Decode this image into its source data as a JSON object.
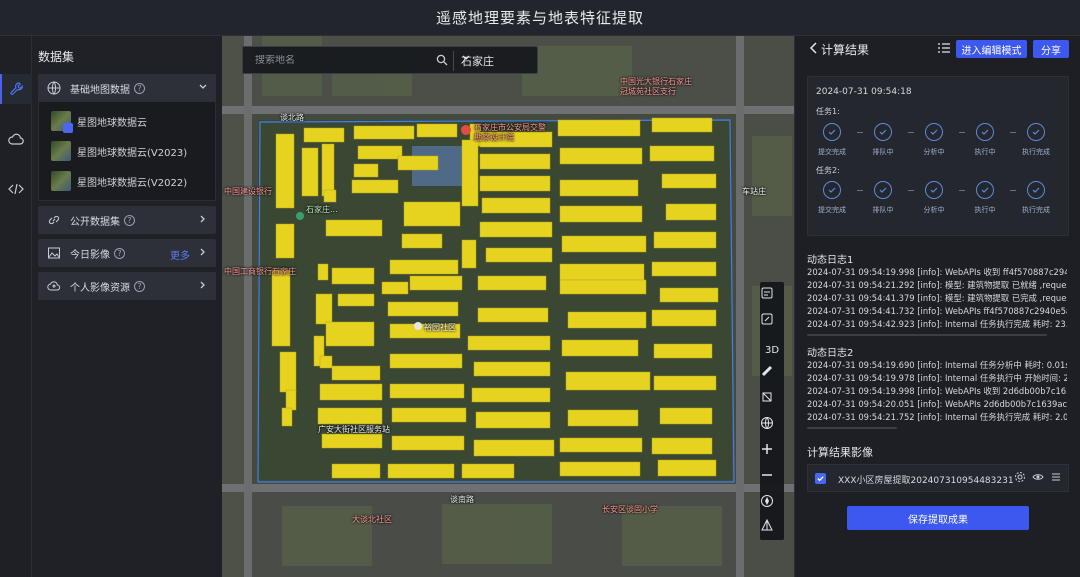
{
  "app": {
    "title": "遥感地理要素与地表特征提取"
  },
  "rail": {
    "icons": [
      "wrench-icon",
      "cloud-icon",
      "code-icon"
    ]
  },
  "panel": {
    "title": "数据集",
    "groups": [
      {
        "label": "基础地图数据",
        "icon": "globe-icon"
      },
      {
        "label": "公开数据集",
        "icon": "link-icon"
      },
      {
        "label": "今日影像",
        "icon": "image-icon",
        "more": "更多"
      },
      {
        "label": "个人影像资源",
        "icon": "cloud-upload-icon"
      }
    ],
    "base_items": [
      {
        "label": "星图地球数据云"
      },
      {
        "label": "星图地球数据云(V2023)"
      },
      {
        "label": "星图地球数据云(V2022)"
      }
    ]
  },
  "map": {
    "search_placeholder": "搜索地名",
    "city": "石家庄",
    "labels": [
      "中国光大银行石家庄",
      "冠城苑社区支行",
      "谈北路",
      "石家庄市公安局交警",
      "勘察设计院",
      "谈北路",
      "中国建设银行",
      "石家庄...",
      "中国工商银行石家庄",
      "车站庄",
      "裕园社区",
      "广安大街社区服务站",
      "谈南路",
      "大谈北社区",
      "长安区谈固小学"
    ]
  },
  "tools": [
    "layer-icon",
    "edit-layer-icon",
    "3D",
    "ruler-icon",
    "area-icon",
    "globe-icon",
    "zoom-in-icon",
    "zoom-out-icon",
    "compass-icon",
    "north-icon"
  ],
  "results": {
    "title": "计算结果",
    "enter_edit": "进入编辑模式",
    "share": "分享",
    "timestamp": "2024-07-31 09:54:18",
    "task1_label": "任务1:",
    "task2_label": "任务2:",
    "task1_steps": [
      "提交完成",
      "排队中",
      "分析中",
      "执行中",
      "执行完成"
    ],
    "task2_steps": [
      "提交完成",
      "排队中",
      "分析中",
      "执行中",
      "执行完成"
    ],
    "log1_title": "动态日志1",
    "log1": [
      "2024-07-31 09:54:19.998 [info]: WebAPIs 收到 ff4f570887c2940e",
      "2024-07-31 09:54:21.292 [info]: 模型: 建筑物提取 已就绪 ,reques",
      "2024-07-31 09:54:41.379 [info]: 模型: 建筑物提取 已完成 ,reques",
      "2024-07-31 09:54:41.732 [info]: WebAPIs ff4f570887c2940e5abel",
      "2024-07-31 09:54:42.923 [info]: Internal 任务执行完成 耗时: 23.2"
    ],
    "log2_title": "动态日志2",
    "log2": [
      "2024-07-31 09:54:19.690 [info]: Internal 任务分析中 耗时: 0.01s ,",
      "2024-07-31 09:54:19.978 [info]: Internal 任务执行中 开始时间: 20",
      "2024-07-31 09:54:19.998 [info]: WebAPIs 收到 2d6db00b7c1639d",
      "2024-07-31 09:54:20.051 [info]: WebAPIs 2d6db00b7c1639ac9cc",
      "2024-07-31 09:54:21.752 [info]: Internal 任务执行完成 耗时: 2.08"
    ],
    "image_section": "计算结果影像",
    "image_name": "XXX小区房屋提取202407310954483231",
    "save": "保存提取成果"
  },
  "colors": {
    "accent": "#3c58ef",
    "building": "#e6d31f",
    "aoi": "#3f7ff0"
  }
}
